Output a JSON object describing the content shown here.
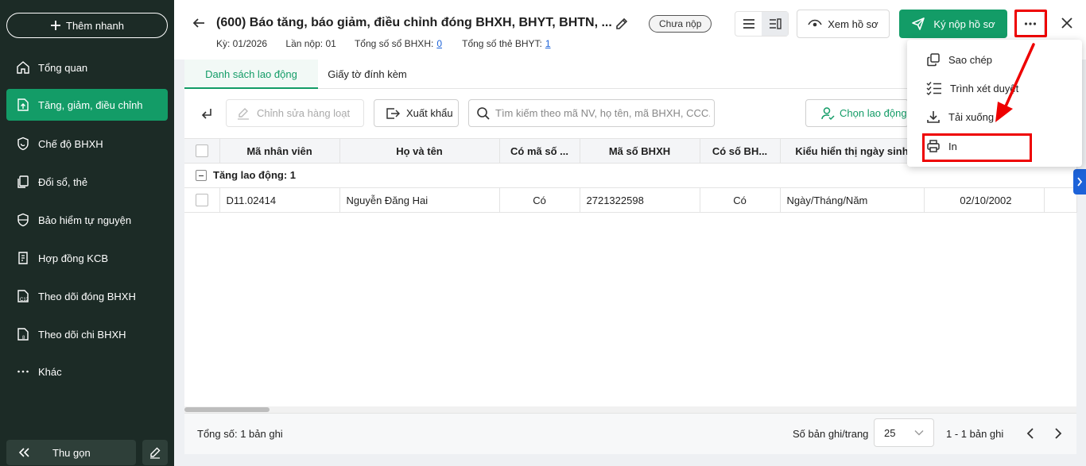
{
  "sidebar": {
    "quick_add_label": "Thêm nhanh",
    "items": [
      {
        "label": "Tổng quan"
      },
      {
        "label": "Tăng, giảm, điều chỉnh"
      },
      {
        "label": "Chế độ BHXH"
      },
      {
        "label": "Đổi sổ, thẻ"
      },
      {
        "label": "Bảo hiểm tự nguyện"
      },
      {
        "label": "Hợp đồng KCB"
      },
      {
        "label": "Theo dõi đóng BHXH"
      },
      {
        "label": "Theo dõi chi BHXH"
      },
      {
        "label": "Khác"
      }
    ],
    "active_index": 1,
    "collapse_label": "Thu gọn"
  },
  "header": {
    "title": "(600) Báo tăng, báo giảm, điều chỉnh đóng BHXH, BHYT, BHTN, ...",
    "status": "Chưa nộp",
    "meta": {
      "period": "Kỳ: 01/2026",
      "submission": "Lần nộp: 01",
      "bhxh_total_label": "Tổng số sổ BHXH:",
      "bhxh_total": "0",
      "bhyt_total_label": "Tổng số thẻ BHYT:",
      "bhyt_total": "1"
    },
    "view_button": "Xem hồ sơ",
    "submit_button": "Ký nộp hồ sơ"
  },
  "tabs": [
    {
      "label": "Danh sách lao động"
    },
    {
      "label": "Giấy tờ đính kèm"
    }
  ],
  "active_tab": 0,
  "toolbar": {
    "bulk_edit": "Chỉnh sửa hàng loạt",
    "export": "Xuất khẩu",
    "search_placeholder": "Tìm kiếm theo mã NV, họ tên, mã BHXH, CCC...",
    "choose": "Chọn lao động"
  },
  "table": {
    "columns": [
      "Mã nhân viên",
      "Họ và tên",
      "Có mã số ...",
      "Mã số BHXH",
      "Có số BH...",
      "Kiểu hiển thị ngày sinh",
      ""
    ],
    "group_label": "Tăng lao động: 1",
    "rows": [
      {
        "ma_nv": "D11.02414",
        "ho_ten": "Nguyễn Đăng Hai",
        "co_ma_so": "Có",
        "ma_bhxh": "2721322598",
        "co_so_bh": "Có",
        "kieu_ngay_sinh": "Ngày/Tháng/Năm",
        "ngay_sinh": "02/10/2002"
      }
    ]
  },
  "footer": {
    "total": "Tổng số: 1 bản ghi",
    "per_page_label": "Số bản ghi/trang",
    "per_page": "25",
    "range": "1 - 1 bản ghi"
  },
  "menu": {
    "items": [
      {
        "label": "Sao chép",
        "icon": "copy-icon"
      },
      {
        "label": "Trình xét duyệt",
        "icon": "checklist-icon"
      },
      {
        "label": "Tải xuống",
        "icon": "download-icon"
      },
      {
        "label": "In",
        "icon": "printer-icon"
      }
    ]
  },
  "colors": {
    "primary": "#139c67",
    "sidebar_bg": "#1c2b26",
    "highlight": "#e00000",
    "link": "#1c62d8"
  }
}
